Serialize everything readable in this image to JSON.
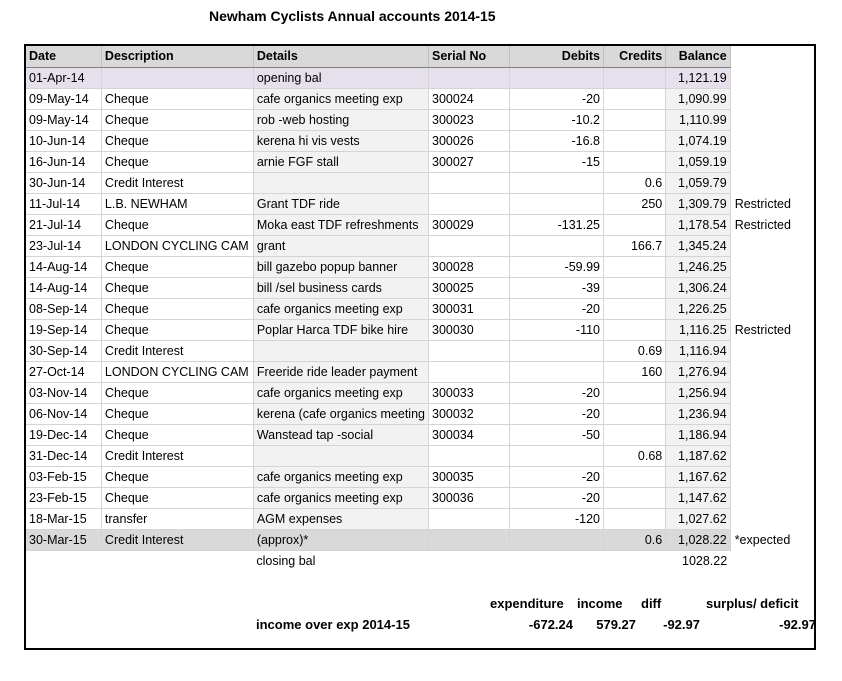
{
  "title": "Newham Cyclists Annual accounts 2014-15",
  "columns": [
    "Date",
    "Description",
    "Details",
    "Serial No",
    "Debits",
    "Credits",
    "Balance"
  ],
  "rows": [
    {
      "date": "01-Apr-14",
      "desc": "",
      "details": "opening bal",
      "serial": "",
      "debit": "",
      "credit": "",
      "balance": "1,121.19",
      "note": ""
    },
    {
      "date": "09-May-14",
      "desc": "Cheque",
      "details": "cafe organics meeting exp",
      "serial": "300024",
      "debit": "-20",
      "credit": "",
      "balance": "1,090.99",
      "note": ""
    },
    {
      "date": "09-May-14",
      "desc": "Cheque",
      "details": "rob -web hosting",
      "serial": "300023",
      "debit": "-10.2",
      "credit": "",
      "balance": "1,110.99",
      "note": ""
    },
    {
      "date": "10-Jun-14",
      "desc": "Cheque",
      "details": "kerena hi vis vests",
      "serial": "300026",
      "debit": "-16.8",
      "credit": "",
      "balance": "1,074.19",
      "note": ""
    },
    {
      "date": "16-Jun-14",
      "desc": "Cheque",
      "details": "arnie FGF stall",
      "serial": "300027",
      "debit": "-15",
      "credit": "",
      "balance": "1,059.19",
      "note": ""
    },
    {
      "date": "30-Jun-14",
      "desc": "Credit Interest",
      "details": "",
      "serial": "",
      "debit": "",
      "credit": "0.6",
      "balance": "1,059.79",
      "note": ""
    },
    {
      "date": "11-Jul-14",
      "desc": "L.B. NEWHAM",
      "details": "Grant TDF ride",
      "serial": "",
      "debit": "",
      "credit": "250",
      "balance": "1,309.79",
      "note": "Restricted"
    },
    {
      "date": "21-Jul-14",
      "desc": "Cheque",
      "details": "Moka east TDF refreshments",
      "serial": "300029",
      "debit": "-131.25",
      "credit": "",
      "balance": "1,178.54",
      "note": "Restricted"
    },
    {
      "date": "23-Jul-14",
      "desc": "LONDON CYCLING CAM",
      "details": "grant",
      "serial": "",
      "debit": "",
      "credit": "166.7",
      "balance": "1,345.24",
      "note": ""
    },
    {
      "date": "14-Aug-14",
      "desc": "Cheque",
      "details": "bill gazebo popup banner",
      "serial": "300028",
      "debit": "-59.99",
      "credit": "",
      "balance": "1,246.25",
      "note": ""
    },
    {
      "date": "14-Aug-14",
      "desc": "Cheque",
      "details": "bill /sel business cards",
      "serial": "300025",
      "debit": "-39",
      "credit": "",
      "balance": "1,306.24",
      "note": ""
    },
    {
      "date": "08-Sep-14",
      "desc": "Cheque",
      "details": "cafe organics meeting exp",
      "serial": "300031",
      "debit": "-20",
      "credit": "",
      "balance": "1,226.25",
      "note": ""
    },
    {
      "date": "19-Sep-14",
      "desc": "Cheque",
      "details": "Poplar Harca TDF bike hire",
      "serial": "300030",
      "debit": "-110",
      "credit": "",
      "balance": "1,116.25",
      "note": "Restricted"
    },
    {
      "date": "30-Sep-14",
      "desc": "Credit Interest",
      "details": "",
      "serial": "",
      "debit": "",
      "credit": "0.69",
      "balance": "1,116.94",
      "note": ""
    },
    {
      "date": "27-Oct-14",
      "desc": "LONDON CYCLING CAM",
      "details": "Freeride ride leader payment",
      "serial": "",
      "debit": "",
      "credit": "160",
      "balance": "1,276.94",
      "note": ""
    },
    {
      "date": "03-Nov-14",
      "desc": "Cheque",
      "details": "cafe organics meeting exp",
      "serial": "300033",
      "debit": "-20",
      "credit": "",
      "balance": "1,256.94",
      "note": ""
    },
    {
      "date": "06-Nov-14",
      "desc": "Cheque",
      "details": "kerena (cafe organics meeting",
      "serial": "300032",
      "debit": "-20",
      "credit": "",
      "balance": "1,236.94",
      "note": ""
    },
    {
      "date": "19-Dec-14",
      "desc": "Cheque",
      "details": "Wanstead tap -social",
      "serial": "300034",
      "debit": "-50",
      "credit": "",
      "balance": "1,186.94",
      "note": ""
    },
    {
      "date": "31-Dec-14",
      "desc": "Credit Interest",
      "details": "",
      "serial": "",
      "debit": "",
      "credit": "0.68",
      "balance": "1,187.62",
      "note": ""
    },
    {
      "date": "03-Feb-15",
      "desc": "Cheque",
      "details": "cafe organics meeting exp",
      "serial": "300035",
      "debit": "-20",
      "credit": "",
      "balance": "1,167.62",
      "note": ""
    },
    {
      "date": "23-Feb-15",
      "desc": "Cheque",
      "details": "cafe organics meeting exp",
      "serial": "300036",
      "debit": "-20",
      "credit": "",
      "balance": "1,147.62",
      "note": ""
    },
    {
      "date": "18-Mar-15",
      "desc": "transfer",
      "details": "AGM expenses",
      "serial": "",
      "debit": "-120",
      "credit": "",
      "balance": "1,027.62",
      "note": ""
    },
    {
      "date": "30-Mar-15",
      "desc": "Credit Interest",
      "details": "(approx)*",
      "serial": "",
      "debit": "",
      "credit": "0.6",
      "balance": "1,028.22",
      "note": "*expected"
    }
  ],
  "closing": {
    "label": "closing bal",
    "balance": "1028.22"
  },
  "summary": {
    "label": "income over exp 2014-15",
    "headers": {
      "expenditure": "expenditure",
      "income": "income",
      "diff": "diff",
      "surplus": "surplus/ deficit"
    },
    "values": {
      "expenditure": "-672.24",
      "income": "579.27",
      "diff": "-92.97",
      "surplus": "-92.97"
    }
  }
}
